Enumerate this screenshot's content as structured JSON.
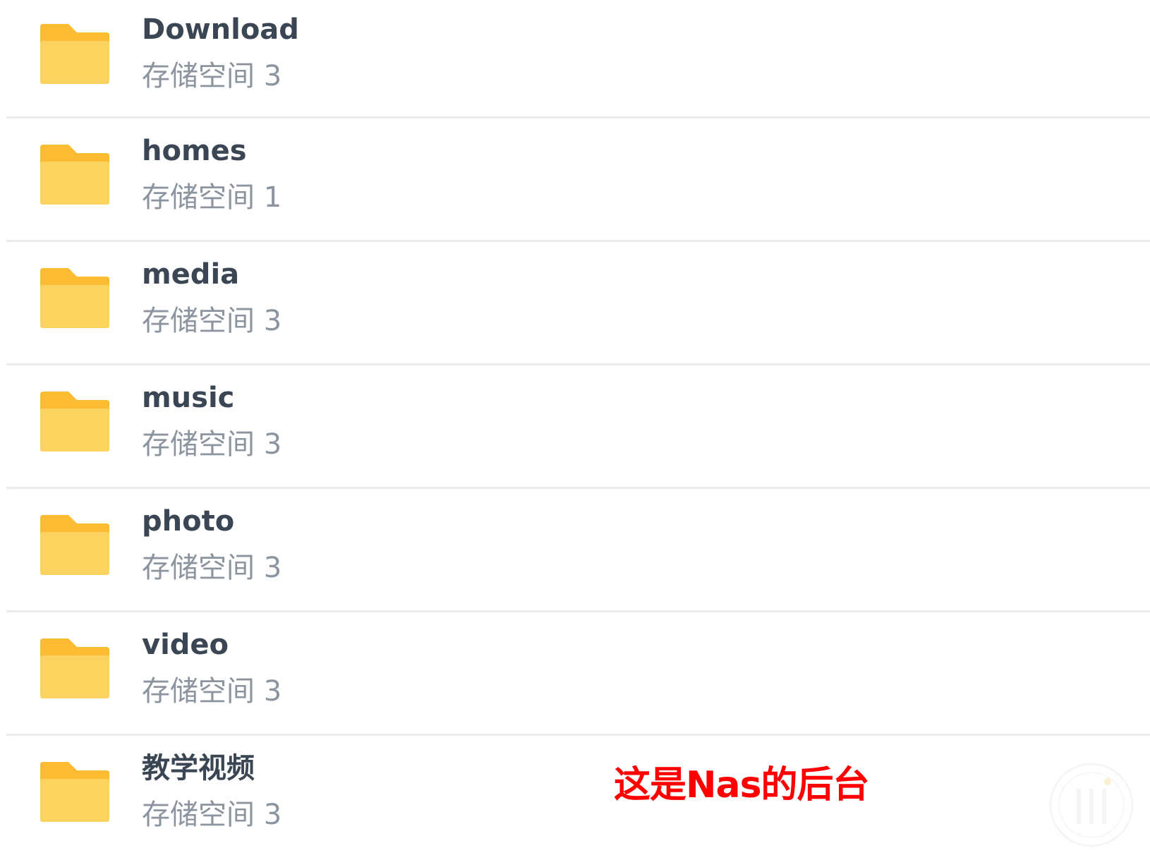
{
  "folders": [
    {
      "name": "Download",
      "volume": "存储空间 3",
      "icon": "folder-icon"
    },
    {
      "name": "homes",
      "volume": "存储空间 1",
      "icon": "folder-icon"
    },
    {
      "name": "media",
      "volume": "存储空间 3",
      "icon": "folder-icon"
    },
    {
      "name": "music",
      "volume": "存储空间 3",
      "icon": "folder-icon"
    },
    {
      "name": "photo",
      "volume": "存储空间 3",
      "icon": "folder-icon"
    },
    {
      "name": "video",
      "volume": "存储空间 3",
      "icon": "folder-icon"
    },
    {
      "name": "教学视频",
      "volume": "存储空间 3",
      "icon": "folder-icon"
    }
  ],
  "annotation": "这是Nas的后台",
  "watermark": {
    "icon": "watermark-logo-icon"
  },
  "colors": {
    "folder_front": "#fdd35f",
    "folder_back": "#fbbc33",
    "name_text": "#3b4654",
    "volume_text": "#8c959f",
    "divider": "#e8ecef",
    "annotation_text": "#ff0000"
  }
}
